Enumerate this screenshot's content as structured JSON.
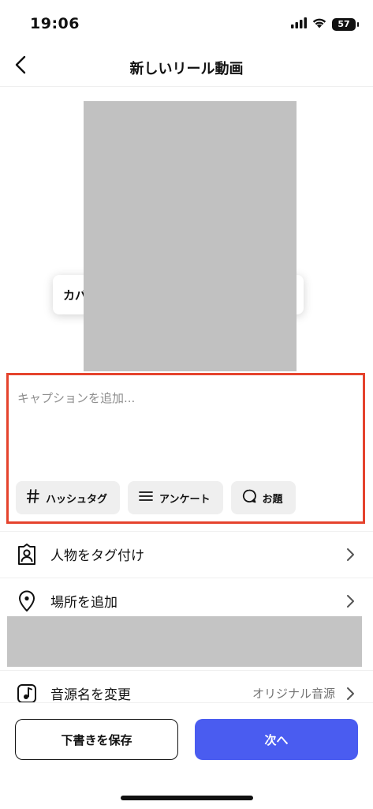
{
  "status_bar": {
    "time": "19:06",
    "battery_level": "57",
    "icons": [
      "signal-icon",
      "wifi-icon",
      "battery-icon"
    ]
  },
  "header": {
    "title": "新しいリール動画",
    "back_icon": "chevron-left-icon"
  },
  "preview": {
    "cover_label": "カバ"
  },
  "caption": {
    "placeholder": "キャプションを追加...",
    "value": "",
    "chips": [
      {
        "label": "ハッシュタグ",
        "icon": "hashtag-icon"
      },
      {
        "label": "アンケート",
        "icon": "list-icon"
      },
      {
        "label": "お題",
        "icon": "speech-bubble-icon"
      }
    ]
  },
  "settings": {
    "tag_people": {
      "label": "人物をタグ付け",
      "icon": "person-tag-icon"
    },
    "add_location": {
      "label": "場所を追加",
      "icon": "location-pin-icon"
    },
    "rename_audio": {
      "label": "音源名を変更",
      "value": "オリジナル音源",
      "icon": "music-note-icon"
    }
  },
  "footer": {
    "save_draft_label": "下書きを保存",
    "next_label": "次へ"
  },
  "colors": {
    "accent": "#4a5cf0",
    "highlight_border": "#e5432d",
    "chip_bg": "#efefef",
    "redacted": "#c1c1c1"
  }
}
